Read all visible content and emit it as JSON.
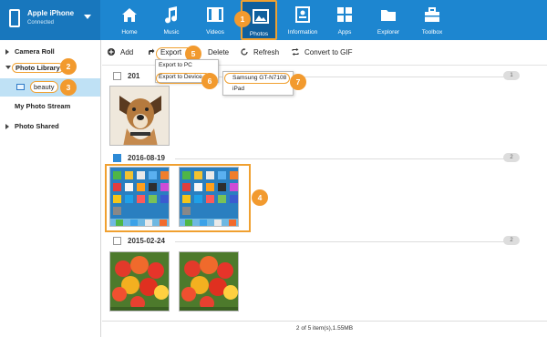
{
  "device": {
    "name": "Apple iPhone",
    "status": "Connected"
  },
  "nav": [
    {
      "label": "Home"
    },
    {
      "label": "Music"
    },
    {
      "label": "Videos"
    },
    {
      "label": "Photos"
    },
    {
      "label": "Information"
    },
    {
      "label": "Apps"
    },
    {
      "label": "Explorer"
    },
    {
      "label": "Toolbox"
    }
  ],
  "sidebar": {
    "camera_roll": "Camera Roll",
    "photo_library": "Photo Library",
    "beauty": "beauty",
    "my_photo_stream": "My Photo Stream",
    "photo_shared": "Photo Shared"
  },
  "toolbar": {
    "add": "Add",
    "export": "Export",
    "delete": "Delete",
    "refresh": "Refresh",
    "convert_gif": "Convert to GIF"
  },
  "export_menu": {
    "to_pc": "Export to PC",
    "to_device": "Export to Device"
  },
  "device_menu": {
    "samsung": "Samsung GT-N7108",
    "ipad": "iPad"
  },
  "groups": [
    {
      "date": "201",
      "count": "1"
    },
    {
      "date": "2016-08-19",
      "count": "2"
    },
    {
      "date": "2015-02-24",
      "count": "2"
    }
  ],
  "status": "2 of 5 item(s),1.55MB",
  "badges": {
    "b1": "1",
    "b2": "2",
    "b3": "3",
    "b4": "4",
    "b5": "5",
    "b6": "6",
    "b7": "7"
  },
  "colors": {
    "topbar": "#1d86d0",
    "accent": "#f29a2e",
    "selected": "#bfe1f5"
  }
}
